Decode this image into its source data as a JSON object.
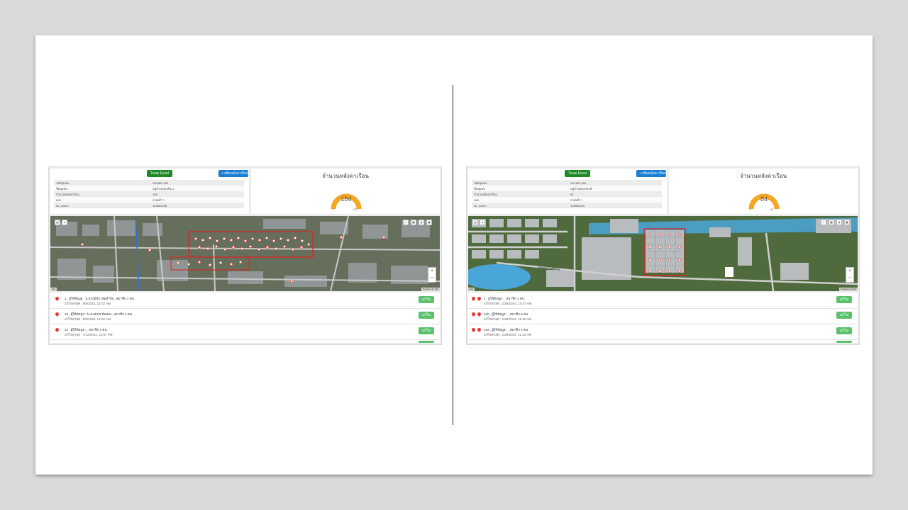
{
  "left": {
    "excel_label": "โหลด Excel",
    "add_label": "+ เพิ่มหลังคาเรือน",
    "info_rows": [
      {
        "k": "รหัสชุมชน",
        "v": "103,851,026"
      },
      {
        "k": "ชื่อชุมชน",
        "v": "หมู่บ้านสุขเจริญ 1"
      },
      {
        "k": "จำนวนหลังคาเรือน",
        "v": "155"
      },
      {
        "k": "เขต",
        "v": "ลาดพร้าว"
      },
      {
        "k": "str_comm",
        "v": "103851026"
      }
    ],
    "gauge_title": "จำนวนหลังคาเรือน",
    "gauge_value": "184",
    "gauge_fraction": 1.0,
    "gauge_min": "0",
    "gauge_max": "155",
    "map_credit_left": "Esri",
    "map_credit_right": "Powered by Esri",
    "list": [
      {
        "title": "1 , ผู้ให้ข้อมูล : น.ส.มณีรัก เทพจำรัส , สมาชิก 4 คน",
        "sub": "แก้ไขล่าสุด : 9/8/2023, 12:02 AM",
        "edit": "แก้ไข"
      },
      {
        "title": "10 , ผู้ให้ข้อมูล : น.ส.สมพร ทับทอง , สมาชิก 4 คน",
        "sub": "แก้ไขล่าสุด : 9/8/2023, 12:02 AM",
        "edit": "แก้ไข"
      },
      {
        "title": "10 , ผู้ให้ข้อมูล : , สมาชิก 3 คน",
        "sub": "แก้ไขล่าสุด : 7/12/2024, 12:57 PM",
        "edit": "แก้ไข"
      }
    ]
  },
  "right": {
    "excel_label": "โหลด Excel",
    "add_label": "+ เพิ่มหลังคาเรือน",
    "info_rows": [
      {
        "k": "รหัสชุมชน",
        "v": "103,802,004"
      },
      {
        "k": "ชื่อชุมชน",
        "v": "หมู่บ้านพฤกษชาติ"
      },
      {
        "k": "จำนวนหลังคาเรือน",
        "v": "82"
      },
      {
        "k": "เขต",
        "v": "ลาดพร้าว"
      },
      {
        "k": "str_comm",
        "v": "103802004"
      }
    ],
    "gauge_title": "จำนวนหลังคาเรือน",
    "gauge_value": "84",
    "gauge_fraction": 1.0,
    "gauge_min": "0",
    "gauge_max": "82",
    "map_road_label": "ซอยหมู่บ้านสิริวงษ์",
    "map_credit_left": "Esri",
    "map_credit_right": "Powered by Esri",
    "list": [
      {
        "title": "1 , ผู้ให้ข้อมูล : , สมาชิก 1 คน",
        "sub": "แก้ไขล่าสุด : 10/8/2024, 10:47 AM",
        "edit": "แก้ไข"
      },
      {
        "title": "100 , ผู้ให้ข้อมูล : , สมาชิก 5 คน",
        "sub": "แก้ไขล่าสุด : 10/8/2024, 11:40 AM",
        "edit": "แก้ไข"
      },
      {
        "title": "102 , ผู้ให้ข้อมูล : , สมาชิก 4 คน",
        "sub": "แก้ไขล่าสุด : 10/8/2024, 11:42 AM",
        "edit": "แก้ไข"
      }
    ]
  },
  "colors": {
    "gauge_arc": "#f5a623",
    "excel_button": "#1e8a25",
    "add_button": "#1a7fd4",
    "edit_button": "#5bc16b",
    "pin": "#e53935",
    "boundary": "#e02020"
  }
}
